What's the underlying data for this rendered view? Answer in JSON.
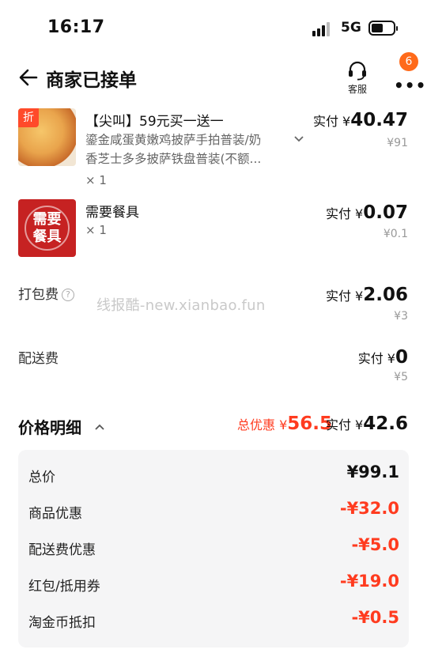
{
  "status_bar": {
    "time": "16:17",
    "network": "5G"
  },
  "header": {
    "title": "商家已接单",
    "service_label": "客服",
    "badge_count": "6"
  },
  "items": [
    {
      "discount_tag": "折",
      "title": "【尖叫】59元买一送一",
      "desc_line1": "鎏金咸蛋黄嫩鸡披萨手拍普装/奶",
      "desc_line2": "香芝士多多披萨铁盘普装(不额...",
      "qty": "× 1",
      "paid_label": "实付 ¥",
      "paid_value": "40.47",
      "original": "¥91"
    },
    {
      "image_text": "需要\n餐具",
      "title": "需要餐具",
      "qty": "× 1",
      "paid_label": "实付 ¥",
      "paid_value": "0.07",
      "original": "¥0.1"
    }
  ],
  "fees": [
    {
      "label": "打包费",
      "has_help": true,
      "paid_label": "实付 ¥",
      "paid_value": "2.06",
      "original": "¥3"
    },
    {
      "label": "配送费",
      "has_help": false,
      "paid_label": "实付 ¥",
      "paid_value": "0",
      "original": "¥5"
    }
  ],
  "watermark": "线报酷-new.xianbao.fun",
  "summary": {
    "title": "价格明细",
    "discount_label": "总优惠 ¥",
    "discount_value": "56.5",
    "paid_label": "实付 ¥",
    "paid_value": "42.6"
  },
  "breakdown": [
    {
      "label": "总价",
      "value": "¥99.1",
      "negative": false
    },
    {
      "label": "商品优惠",
      "value": "-¥32.0",
      "negative": true
    },
    {
      "label": "配送费优惠",
      "value": "-¥5.0",
      "negative": true
    },
    {
      "label": "红包/抵用券",
      "value": "-¥19.0",
      "negative": true
    },
    {
      "label": "淘金币抵扣",
      "value": "-¥0.5",
      "negative": true
    }
  ],
  "colors": {
    "accent": "#ff3b1f",
    "badge": "#ff6a1a",
    "tableware": "#c62222",
    "panel": "#f5f5f6"
  },
  "icons": [
    "signal-icon",
    "battery-icon",
    "back-arrow-icon",
    "headset-icon",
    "more-icon",
    "chevron-down-icon",
    "help-icon",
    "chevron-up-icon"
  ]
}
